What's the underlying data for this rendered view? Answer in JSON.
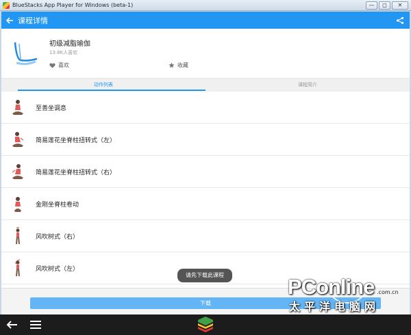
{
  "window": {
    "title": "BlueStacks App Player for Windows (beta-1)",
    "minimize": "—",
    "maximize": "◻",
    "close": "✕"
  },
  "appbar": {
    "title": "课程详情"
  },
  "course": {
    "name": "初级减脂瑜伽",
    "likes": "13.8K人喜欢",
    "like_label": "喜欢",
    "favorite_label": "收藏"
  },
  "tabs": [
    {
      "label": "动作列表",
      "active": true
    },
    {
      "label": "课程简介",
      "active": false
    }
  ],
  "poses": [
    {
      "label": "至善坐调息"
    },
    {
      "label": "简易莲花坐脊柱扭转式（左）"
    },
    {
      "label": "简易莲花坐脊柱扭转式（右）"
    },
    {
      "label": "金刚坐脊柱卷动"
    },
    {
      "label": "风吹树式（右）"
    },
    {
      "label": "风吹树式（左）"
    }
  ],
  "download_label": "下载",
  "toast": "请先下载此课程",
  "watermark": {
    "brand": "PConline",
    "suffix": ".com.cn",
    "cn": "太平洋电脑网"
  },
  "colors": {
    "accent": "#2196f3",
    "download": "#64b5f6",
    "pose_top": "#e35a5a"
  }
}
